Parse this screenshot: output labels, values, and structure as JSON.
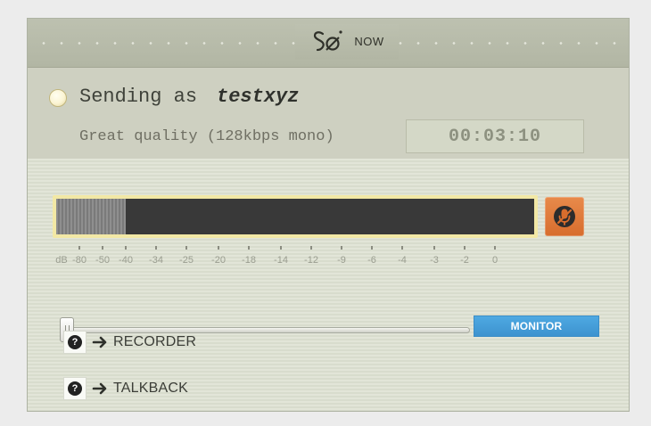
{
  "titlebar": {
    "brand_text": "NOW",
    "logo_icon": "source-elements-logo-icon"
  },
  "status": {
    "sending_label": "Sending as",
    "username": "testxyz",
    "quality": "Great quality (128kbps mono)",
    "elapsed_time": "00:03:10",
    "indicator_icon": "status-light-icon"
  },
  "meter": {
    "level_fraction": 0.145,
    "scale_labels": [
      "dB",
      "-80",
      "-50",
      "-40",
      "-34",
      "-25",
      "-20",
      "-18",
      "-14",
      "-12",
      "-9",
      "-6",
      "-4",
      "-3",
      "-2",
      "0"
    ],
    "mute_icon": "microphone-mute-icon"
  },
  "controls": {
    "monitor_label": "MONITOR",
    "slider_value_fraction": 0.0
  },
  "links": {
    "recorder_label": "RECORDER",
    "talkback_label": "TALKBACK",
    "help_icon": "help-icon",
    "arrow_icon": "arrow-right-icon"
  }
}
